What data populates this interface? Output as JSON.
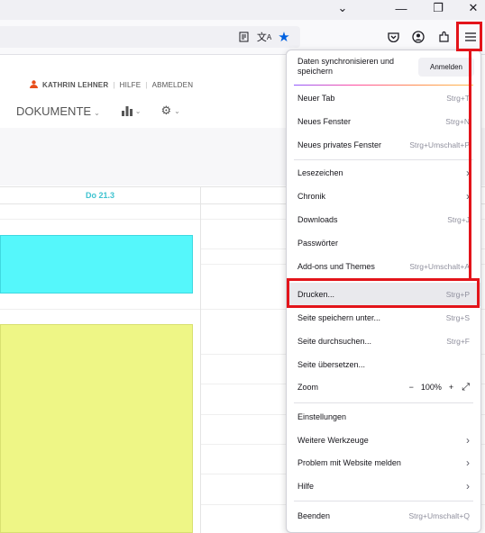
{
  "window_controls": {
    "chevron": "⌄",
    "minimize": "—",
    "restore": "❐",
    "close": "✕"
  },
  "toolbar_icons": {
    "reader": "reader-view-icon",
    "translate": "translate-icon",
    "bookmark": "bookmark-star-icon",
    "pocket": "pocket-icon",
    "account": "account-icon",
    "extensions": "extensions-icon",
    "menu": "hamburger-menu-icon"
  },
  "page": {
    "user_name": "KATHRIN LEHNER",
    "help": "HILFE",
    "logout": "ABMELDEN",
    "nav_documents": "DOKUMENTE",
    "day_header": "Do 21.3"
  },
  "menu": {
    "sync_text": "Daten synchronisieren und speichern",
    "sign_in": "Anmelden",
    "items": [
      {
        "label": "Neuer Tab",
        "shortcut": "Strg+T"
      },
      {
        "label": "Neues Fenster",
        "shortcut": "Strg+N"
      },
      {
        "label": "Neues privates Fenster",
        "shortcut": "Strg+Umschalt+P"
      },
      {
        "label": "Lesezeichen",
        "shortcut": ""
      },
      {
        "label": "Chronik",
        "shortcut": ""
      },
      {
        "label": "Downloads",
        "shortcut": "Strg+J"
      },
      {
        "label": "Passwörter",
        "shortcut": ""
      },
      {
        "label": "Add-ons und Themes",
        "shortcut": "Strg+Umschalt+A"
      },
      {
        "label": "Drucken...",
        "shortcut": "Strg+P"
      },
      {
        "label": "Seite speichern unter...",
        "shortcut": "Strg+S"
      },
      {
        "label": "Seite durchsuchen...",
        "shortcut": "Strg+F"
      },
      {
        "label": "Seite übersetzen...",
        "shortcut": ""
      },
      {
        "label": "Zoom",
        "shortcut": ""
      },
      {
        "label": "Einstellungen",
        "shortcut": ""
      },
      {
        "label": "Weitere Werkzeuge",
        "shortcut": ""
      },
      {
        "label": "Problem mit Website melden",
        "shortcut": ""
      },
      {
        "label": "Hilfe",
        "shortcut": ""
      },
      {
        "label": "Beenden",
        "shortcut": "Strg+Umschalt+Q"
      }
    ],
    "zoom": {
      "minus": "−",
      "value": "100%",
      "plus": "+"
    }
  },
  "colors": {
    "highlight": "#e3141a",
    "cyan_block": "#55f7fb",
    "yellow_block": "#eef686",
    "day_header": "#3fc3d0",
    "user_icon": "#e84e1b"
  }
}
